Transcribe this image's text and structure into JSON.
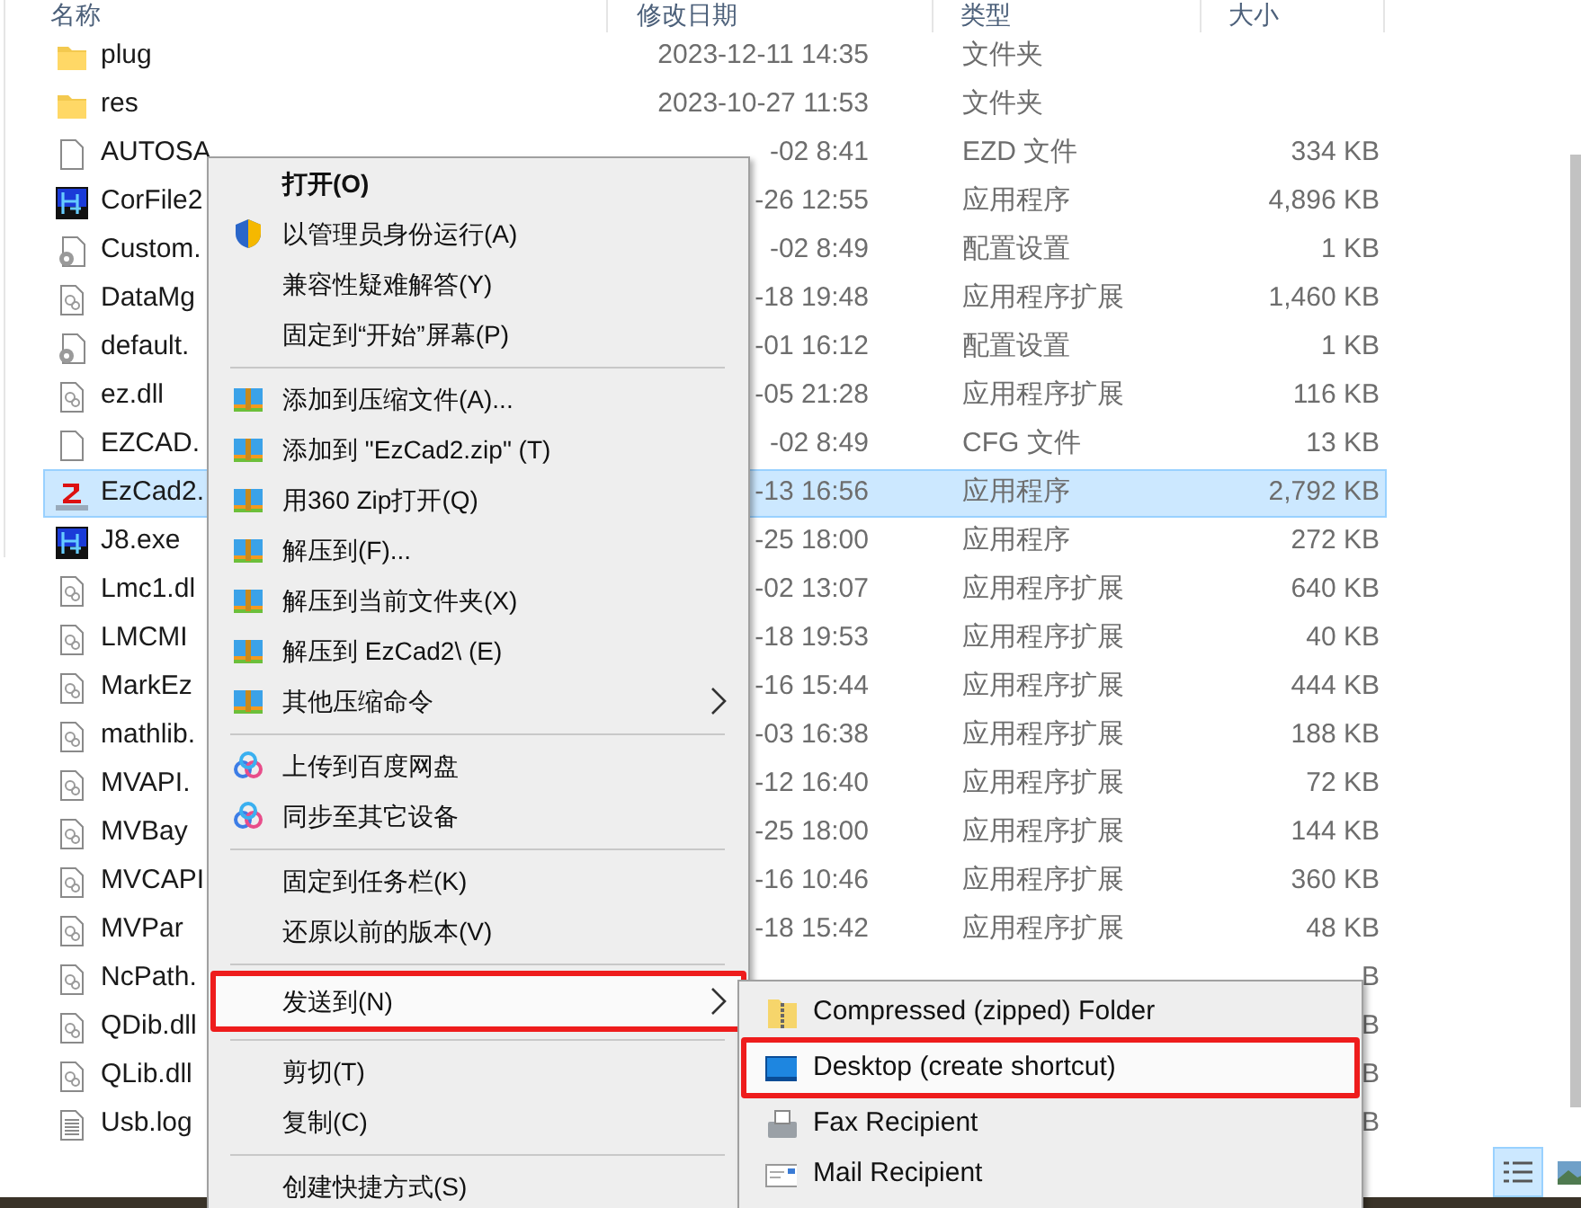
{
  "columns": [
    "名称",
    "修改日期",
    "类型",
    "大小"
  ],
  "files": [
    {
      "name": "plug",
      "kind": "folder",
      "date": "2023-12-11 14:35",
      "type": "文件夹",
      "selected": false
    },
    {
      "name": "res",
      "kind": "folder",
      "date": "2023-10-27 11:53",
      "type": "文件夹",
      "selected": false
    },
    {
      "name": "AUTOSA",
      "kind": "blank",
      "date": "-02 8:41",
      "type": "EZD 文件",
      "size": "334 KB",
      "selected": false
    },
    {
      "name": "CorFile2",
      "kind": "app",
      "date": "-26 12:55",
      "type": "应用程序",
      "size": "4,896 KB",
      "selected": false
    },
    {
      "name": "Custom.",
      "kind": "config",
      "date": "-02 8:49",
      "type": "配置设置",
      "size": "1 KB",
      "selected": false
    },
    {
      "name": "DataMg",
      "kind": "dll",
      "date": "-18 19:48",
      "type": "应用程序扩展",
      "size": "1,460 KB",
      "selected": false
    },
    {
      "name": "default.",
      "kind": "config",
      "date": "-01 16:12",
      "type": "配置设置",
      "size": "1 KB",
      "selected": false
    },
    {
      "name": "ez.dll",
      "kind": "dll",
      "date": "-05 21:28",
      "type": "应用程序扩展",
      "size": "116 KB",
      "selected": false
    },
    {
      "name": "EZCAD.",
      "kind": "blank",
      "date": "-02 8:49",
      "type": "CFG 文件",
      "size": "13 KB",
      "selected": false
    },
    {
      "name": "EzCad2.",
      "kind": "ezcad",
      "date": "-13 16:56",
      "type": "应用程序",
      "size": "2,792 KB",
      "selected": true
    },
    {
      "name": "J8.exe",
      "kind": "app",
      "date": "-25 18:00",
      "type": "应用程序",
      "size": "272 KB",
      "selected": false
    },
    {
      "name": "Lmc1.dl",
      "kind": "dll",
      "date": "-02 13:07",
      "type": "应用程序扩展",
      "size": "640 KB",
      "selected": false
    },
    {
      "name": "LMCMI",
      "kind": "dll",
      "date": "-18 19:53",
      "type": "应用程序扩展",
      "size": "40 KB",
      "selected": false
    },
    {
      "name": "MarkEz",
      "kind": "dll",
      "date": "-16 15:44",
      "type": "应用程序扩展",
      "size": "444 KB",
      "selected": false
    },
    {
      "name": "mathlib.",
      "kind": "dll",
      "date": "-03 16:38",
      "type": "应用程序扩展",
      "size": "188 KB",
      "selected": false
    },
    {
      "name": "MVAPI.",
      "kind": "dll",
      "date": "-12 16:40",
      "type": "应用程序扩展",
      "size": "72 KB",
      "selected": false
    },
    {
      "name": "MVBay",
      "kind": "dll",
      "date": "-25 18:00",
      "type": "应用程序扩展",
      "size": "144 KB",
      "selected": false
    },
    {
      "name": "MVCAPI",
      "kind": "dll",
      "date": "-16 10:46",
      "type": "应用程序扩展",
      "size": "360 KB",
      "selected": false
    },
    {
      "name": "MVPar",
      "kind": "dll",
      "date": "-18 15:42",
      "type": "应用程序扩展",
      "size": "48 KB",
      "selected": false
    },
    {
      "name": "NcPath.",
      "kind": "dll",
      "size": "B",
      "selected": false
    },
    {
      "name": "QDib.dll",
      "kind": "dll",
      "size": "B",
      "selected": false
    },
    {
      "name": "QLib.dll",
      "kind": "dll",
      "size": "B",
      "selected": false
    },
    {
      "name": "Usb.log",
      "kind": "log",
      "size": "B",
      "selected": false
    }
  ],
  "context_menu": [
    {
      "kind": "plain",
      "label": "打开(O)",
      "default": true,
      "submenu": false,
      "highlighted": false,
      "annotated": false
    },
    {
      "kind": "shield",
      "label": "以管理员身份运行(A)",
      "default": false,
      "submenu": false,
      "highlighted": false,
      "annotated": false
    },
    {
      "kind": "plain",
      "label": "兼容性疑难解答(Y)",
      "default": false,
      "submenu": false,
      "highlighted": false,
      "annotated": false
    },
    {
      "kind": "plain",
      "label": "固定到“开始”屏幕(P)",
      "default": false,
      "submenu": false,
      "highlighted": false,
      "annotated": false
    },
    {
      "kind": "separator"
    },
    {
      "kind": "archive",
      "label": "添加到压缩文件(A)...",
      "default": false,
      "submenu": false,
      "highlighted": false,
      "annotated": false
    },
    {
      "kind": "archive",
      "label": "添加到 \"EzCad2.zip\" (T)",
      "default": false,
      "submenu": false,
      "highlighted": false,
      "annotated": false
    },
    {
      "kind": "archive",
      "label": "用360 Zip打开(Q)",
      "default": false,
      "submenu": false,
      "highlighted": false,
      "annotated": false
    },
    {
      "kind": "archive",
      "label": "解压到(F)...",
      "default": false,
      "submenu": false,
      "highlighted": false,
      "annotated": false
    },
    {
      "kind": "archive",
      "label": "解压到当前文件夹(X)",
      "default": false,
      "submenu": false,
      "highlighted": false,
      "annotated": false
    },
    {
      "kind": "archive",
      "label": "解压到 EzCad2\\ (E)",
      "default": false,
      "submenu": false,
      "highlighted": false,
      "annotated": false
    },
    {
      "kind": "archive",
      "label": "其他压缩命令",
      "default": false,
      "submenu": true,
      "highlighted": false,
      "annotated": false
    },
    {
      "kind": "separator"
    },
    {
      "kind": "cloud",
      "label": "上传到百度网盘",
      "default": false,
      "submenu": false,
      "highlighted": false,
      "annotated": false
    },
    {
      "kind": "cloud",
      "label": "同步至其它设备",
      "default": false,
      "submenu": false,
      "highlighted": false,
      "annotated": false
    },
    {
      "kind": "separator"
    },
    {
      "kind": "plain",
      "label": "固定到任务栏(K)",
      "default": false,
      "submenu": false,
      "highlighted": false,
      "annotated": false
    },
    {
      "kind": "plain",
      "label": "还原以前的版本(V)",
      "default": false,
      "submenu": false,
      "highlighted": false,
      "annotated": false
    },
    {
      "kind": "separator"
    },
    {
      "kind": "plain",
      "label": "发送到(N)",
      "default": false,
      "submenu": true,
      "highlighted": true,
      "annotated": true
    },
    {
      "kind": "separator"
    },
    {
      "kind": "plain",
      "label": "剪切(T)",
      "default": false,
      "submenu": false,
      "highlighted": false,
      "annotated": false
    },
    {
      "kind": "plain",
      "label": "复制(C)",
      "default": false,
      "submenu": false,
      "highlighted": false,
      "annotated": false
    },
    {
      "kind": "separator"
    },
    {
      "kind": "plain",
      "label": "创建快捷方式(S)",
      "default": false,
      "submenu": false,
      "highlighted": false,
      "annotated": false
    }
  ],
  "send_to_menu": [
    {
      "kind": "zip",
      "label": "Compressed (zipped) Folder",
      "highlighted": false,
      "annotated": false
    },
    {
      "kind": "desktop",
      "label": "Desktop (create shortcut)",
      "highlighted": true,
      "annotated": true
    },
    {
      "kind": "fax",
      "label": "Fax Recipient",
      "highlighted": false,
      "annotated": false
    },
    {
      "kind": "mail",
      "label": "Mail Recipient",
      "highlighted": false,
      "annotated": false
    }
  ],
  "view_buttons": [
    {
      "kind": "details",
      "selected": true
    },
    {
      "kind": "large_icons",
      "selected": false
    }
  ]
}
